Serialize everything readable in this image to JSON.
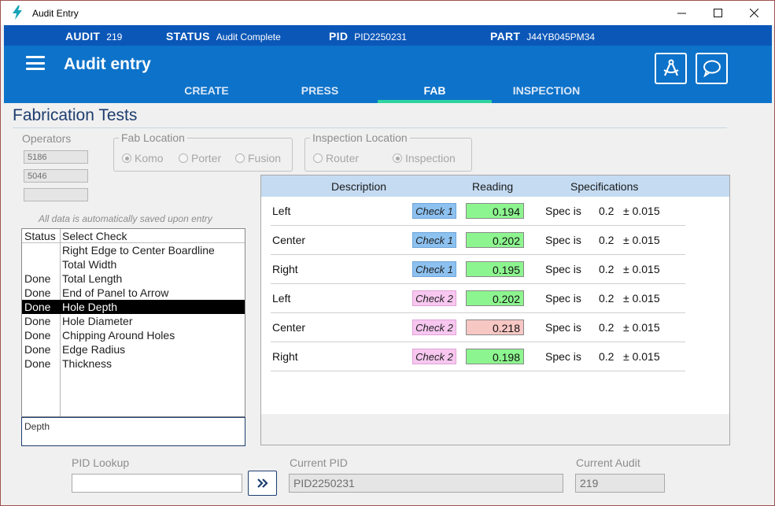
{
  "window": {
    "title": "Audit Entry"
  },
  "infobar": {
    "audit_label": "AUDIT",
    "audit_value": "219",
    "status_label": "STATUS",
    "status_value": "Audit Complete",
    "pid_label": "PID",
    "pid_value": "PID2250231",
    "part_label": "PART",
    "part_value": "J44YB045PM34"
  },
  "header": {
    "title": "Audit entry"
  },
  "tabs": [
    {
      "label": "CREATE",
      "active": false
    },
    {
      "label": "PRESS",
      "active": false
    },
    {
      "label": "FAB",
      "active": true
    },
    {
      "label": "INSPECTION",
      "active": false
    }
  ],
  "section_title": "Fabrication Tests",
  "operators": {
    "label": "Operators",
    "values": [
      "5186",
      "5046",
      ""
    ]
  },
  "fab_location": {
    "label": "Fab Location",
    "options": [
      {
        "label": "Komo",
        "selected": true
      },
      {
        "label": "Porter",
        "selected": false
      },
      {
        "label": "Fusion",
        "selected": false
      }
    ]
  },
  "inspection_location": {
    "label": "Inspection Location",
    "options": [
      {
        "label": "Router",
        "selected": false
      },
      {
        "label": "Inspection",
        "selected": true
      }
    ]
  },
  "autosave_note": "All data is automatically saved upon entry",
  "checklist": {
    "headers": {
      "status": "Status",
      "check": "Select Check"
    },
    "rows": [
      {
        "status": "",
        "check": "Right Edge to Center Boardline"
      },
      {
        "status": "",
        "check": "Total Width"
      },
      {
        "status": "Done",
        "check": "Total Length"
      },
      {
        "status": "Done",
        "check": "End of Panel to Arrow"
      },
      {
        "status": "Done",
        "check": "Hole Depth",
        "selected": true
      },
      {
        "status": "Done",
        "check": "Hole Diameter"
      },
      {
        "status": "Done",
        "check": "Chipping Around Holes"
      },
      {
        "status": "Done",
        "check": "Edge Radius"
      },
      {
        "status": "Done",
        "check": "Thickness"
      }
    ],
    "detail_text": "Depth"
  },
  "readings_table": {
    "headers": {
      "description": "Description",
      "reading": "Reading",
      "specifications": "Specifications"
    },
    "rows": [
      {
        "description": "Left",
        "check": "Check 1",
        "reading": "0.194",
        "in_spec": true,
        "spec_prefix": "Spec is",
        "spec_value": "0.2",
        "tolerance": "± 0.015"
      },
      {
        "description": "Center",
        "check": "Check 1",
        "reading": "0.202",
        "in_spec": true,
        "spec_prefix": "Spec is",
        "spec_value": "0.2",
        "tolerance": "± 0.015"
      },
      {
        "description": "Right",
        "check": "Check 1",
        "reading": "0.195",
        "in_spec": true,
        "spec_prefix": "Spec is",
        "spec_value": "0.2",
        "tolerance": "± 0.015"
      },
      {
        "description": "Left",
        "check": "Check 2",
        "reading": "0.202",
        "in_spec": true,
        "spec_prefix": "Spec is",
        "spec_value": "0.2",
        "tolerance": "± 0.015"
      },
      {
        "description": "Center",
        "check": "Check 2",
        "reading": "0.218",
        "in_spec": false,
        "spec_prefix": "Spec is",
        "spec_value": "0.2",
        "tolerance": "± 0.015"
      },
      {
        "description": "Right",
        "check": "Check 2",
        "reading": "0.198",
        "in_spec": true,
        "spec_prefix": "Spec is",
        "spec_value": "0.2",
        "tolerance": "± 0.015"
      }
    ]
  },
  "footer": {
    "pid_lookup_label": "PID Lookup",
    "pid_lookup_value": "",
    "go_button_icon": "double-chevron-right-icon",
    "current_pid_label": "Current PID",
    "current_pid_value": "PID2250231",
    "current_audit_label": "Current Audit",
    "current_audit_value": "219"
  },
  "colors": {
    "header_blue": "#0d72c9",
    "infobar_blue": "#0b57b8",
    "tab_indicator": "#2ed3a0",
    "check1": "#8cc1f0",
    "check2": "#f7c7f0",
    "in_spec": "#8df58f",
    "out_of_spec": "#f7c7c4"
  }
}
